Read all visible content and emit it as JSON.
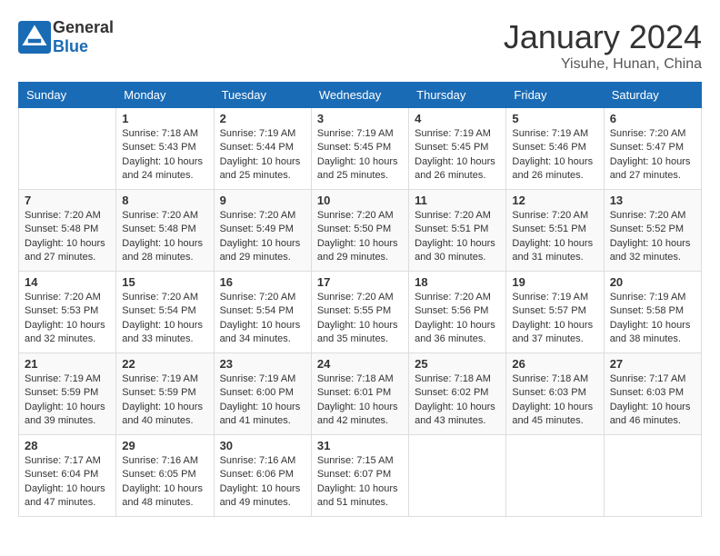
{
  "header": {
    "logo_general": "General",
    "logo_blue": "Blue",
    "month_title": "January 2024",
    "location": "Yisuhe, Hunan, China"
  },
  "days_of_week": [
    "Sunday",
    "Monday",
    "Tuesday",
    "Wednesday",
    "Thursday",
    "Friday",
    "Saturday"
  ],
  "weeks": [
    [
      {
        "day": "",
        "sunrise": "",
        "sunset": "",
        "daylight": ""
      },
      {
        "day": "1",
        "sunrise": "7:18 AM",
        "sunset": "5:43 PM",
        "daylight": "10 hours and 24 minutes."
      },
      {
        "day": "2",
        "sunrise": "7:19 AM",
        "sunset": "5:44 PM",
        "daylight": "10 hours and 25 minutes."
      },
      {
        "day": "3",
        "sunrise": "7:19 AM",
        "sunset": "5:45 PM",
        "daylight": "10 hours and 25 minutes."
      },
      {
        "day": "4",
        "sunrise": "7:19 AM",
        "sunset": "5:45 PM",
        "daylight": "10 hours and 26 minutes."
      },
      {
        "day": "5",
        "sunrise": "7:19 AM",
        "sunset": "5:46 PM",
        "daylight": "10 hours and 26 minutes."
      },
      {
        "day": "6",
        "sunrise": "7:20 AM",
        "sunset": "5:47 PM",
        "daylight": "10 hours and 27 minutes."
      }
    ],
    [
      {
        "day": "7",
        "sunrise": "7:20 AM",
        "sunset": "5:48 PM",
        "daylight": "10 hours and 27 minutes."
      },
      {
        "day": "8",
        "sunrise": "7:20 AM",
        "sunset": "5:48 PM",
        "daylight": "10 hours and 28 minutes."
      },
      {
        "day": "9",
        "sunrise": "7:20 AM",
        "sunset": "5:49 PM",
        "daylight": "10 hours and 29 minutes."
      },
      {
        "day": "10",
        "sunrise": "7:20 AM",
        "sunset": "5:50 PM",
        "daylight": "10 hours and 29 minutes."
      },
      {
        "day": "11",
        "sunrise": "7:20 AM",
        "sunset": "5:51 PM",
        "daylight": "10 hours and 30 minutes."
      },
      {
        "day": "12",
        "sunrise": "7:20 AM",
        "sunset": "5:51 PM",
        "daylight": "10 hours and 31 minutes."
      },
      {
        "day": "13",
        "sunrise": "7:20 AM",
        "sunset": "5:52 PM",
        "daylight": "10 hours and 32 minutes."
      }
    ],
    [
      {
        "day": "14",
        "sunrise": "7:20 AM",
        "sunset": "5:53 PM",
        "daylight": "10 hours and 32 minutes."
      },
      {
        "day": "15",
        "sunrise": "7:20 AM",
        "sunset": "5:54 PM",
        "daylight": "10 hours and 33 minutes."
      },
      {
        "day": "16",
        "sunrise": "7:20 AM",
        "sunset": "5:54 PM",
        "daylight": "10 hours and 34 minutes."
      },
      {
        "day": "17",
        "sunrise": "7:20 AM",
        "sunset": "5:55 PM",
        "daylight": "10 hours and 35 minutes."
      },
      {
        "day": "18",
        "sunrise": "7:20 AM",
        "sunset": "5:56 PM",
        "daylight": "10 hours and 36 minutes."
      },
      {
        "day": "19",
        "sunrise": "7:19 AM",
        "sunset": "5:57 PM",
        "daylight": "10 hours and 37 minutes."
      },
      {
        "day": "20",
        "sunrise": "7:19 AM",
        "sunset": "5:58 PM",
        "daylight": "10 hours and 38 minutes."
      }
    ],
    [
      {
        "day": "21",
        "sunrise": "7:19 AM",
        "sunset": "5:59 PM",
        "daylight": "10 hours and 39 minutes."
      },
      {
        "day": "22",
        "sunrise": "7:19 AM",
        "sunset": "5:59 PM",
        "daylight": "10 hours and 40 minutes."
      },
      {
        "day": "23",
        "sunrise": "7:19 AM",
        "sunset": "6:00 PM",
        "daylight": "10 hours and 41 minutes."
      },
      {
        "day": "24",
        "sunrise": "7:18 AM",
        "sunset": "6:01 PM",
        "daylight": "10 hours and 42 minutes."
      },
      {
        "day": "25",
        "sunrise": "7:18 AM",
        "sunset": "6:02 PM",
        "daylight": "10 hours and 43 minutes."
      },
      {
        "day": "26",
        "sunrise": "7:18 AM",
        "sunset": "6:03 PM",
        "daylight": "10 hours and 45 minutes."
      },
      {
        "day": "27",
        "sunrise": "7:17 AM",
        "sunset": "6:03 PM",
        "daylight": "10 hours and 46 minutes."
      }
    ],
    [
      {
        "day": "28",
        "sunrise": "7:17 AM",
        "sunset": "6:04 PM",
        "daylight": "10 hours and 47 minutes."
      },
      {
        "day": "29",
        "sunrise": "7:16 AM",
        "sunset": "6:05 PM",
        "daylight": "10 hours and 48 minutes."
      },
      {
        "day": "30",
        "sunrise": "7:16 AM",
        "sunset": "6:06 PM",
        "daylight": "10 hours and 49 minutes."
      },
      {
        "day": "31",
        "sunrise": "7:15 AM",
        "sunset": "6:07 PM",
        "daylight": "10 hours and 51 minutes."
      },
      {
        "day": "",
        "sunrise": "",
        "sunset": "",
        "daylight": ""
      },
      {
        "day": "",
        "sunrise": "",
        "sunset": "",
        "daylight": ""
      },
      {
        "day": "",
        "sunrise": "",
        "sunset": "",
        "daylight": ""
      }
    ]
  ]
}
